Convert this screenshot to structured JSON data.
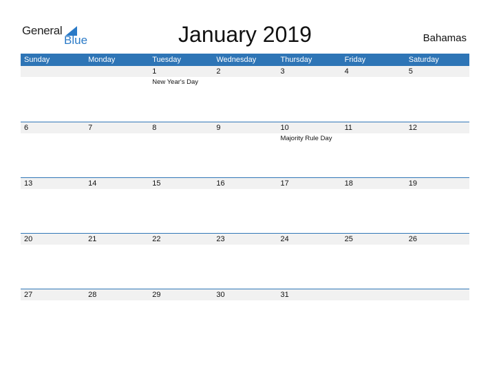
{
  "logo": {
    "text1": "General",
    "text2": "Blue"
  },
  "title": "January 2019",
  "country": "Bahamas",
  "colors": {
    "accent": "#2e75b6",
    "strip": "#f1f1f1"
  },
  "weekdays": [
    "Sunday",
    "Monday",
    "Tuesday",
    "Wednesday",
    "Thursday",
    "Friday",
    "Saturday"
  ],
  "weeks": [
    {
      "days": [
        "",
        "",
        "1",
        "2",
        "3",
        "4",
        "5"
      ],
      "events": [
        "",
        "",
        "New Year's Day",
        "",
        "",
        "",
        ""
      ]
    },
    {
      "days": [
        "6",
        "7",
        "8",
        "9",
        "10",
        "11",
        "12"
      ],
      "events": [
        "",
        "",
        "",
        "",
        "Majority Rule Day",
        "",
        ""
      ]
    },
    {
      "days": [
        "13",
        "14",
        "15",
        "16",
        "17",
        "18",
        "19"
      ],
      "events": [
        "",
        "",
        "",
        "",
        "",
        "",
        ""
      ]
    },
    {
      "days": [
        "20",
        "21",
        "22",
        "23",
        "24",
        "25",
        "26"
      ],
      "events": [
        "",
        "",
        "",
        "",
        "",
        "",
        ""
      ]
    },
    {
      "days": [
        "27",
        "28",
        "29",
        "30",
        "31",
        "",
        ""
      ],
      "events": [
        "",
        "",
        "",
        "",
        "",
        "",
        ""
      ]
    }
  ]
}
